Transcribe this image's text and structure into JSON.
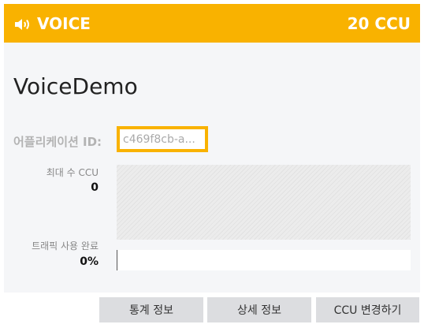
{
  "header": {
    "title": "VOICE",
    "ccu": "20 CCU",
    "icon": "speaker-icon"
  },
  "app": {
    "name": "VoiceDemo",
    "id_label": "어플리케이션 ID:",
    "id_value": "c469f8cb-a..."
  },
  "stats": {
    "max_ccu_label": "최대 수 CCU",
    "max_ccu_value": "0",
    "traffic_label": "트래픽 사용 완료",
    "traffic_value": "0%",
    "traffic_percent": 0
  },
  "buttons": {
    "stats": "통계 정보",
    "details": "상세 정보",
    "change_ccu": "CCU 변경하기"
  },
  "colors": {
    "accent": "#f9b200",
    "card_bg": "#f5f6f8",
    "button_bg": "#dcdde0"
  }
}
